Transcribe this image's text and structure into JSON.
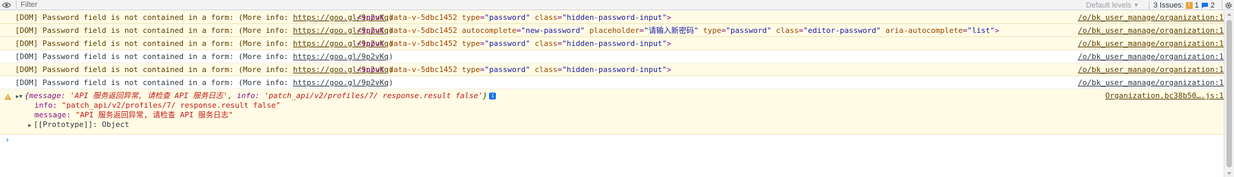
{
  "toolbar": {
    "filter_placeholder": "Filter",
    "levels_label": "Default levels",
    "issues_label": "3 Issues:",
    "warn_count": "1",
    "info_count": "2"
  },
  "log_rows": [
    {
      "type": "warn",
      "message_prefix": "[DOM] Password field is not contained in a form: (More info: ",
      "link": "https://goo.gl/9p2vKq",
      "message_suffix": ")",
      "element": {
        "open": "<input",
        "attrs": [
          {
            "name": "data-v-5dbc1452",
            "value": ""
          },
          {
            "name": "type",
            "value": "\"password\""
          },
          {
            "name": "class",
            "value": "\"hidden-password-input\""
          }
        ],
        "close": ">"
      },
      "source": "/o/bk_user_manage/organization:1"
    },
    {
      "type": "warn",
      "message_prefix": "[DOM] Password field is not contained in a form: (More info: ",
      "link": "https://goo.gl/9p2vKq",
      "message_suffix": ")",
      "element": {
        "open": "<input",
        "attrs": [
          {
            "name": "data-v-5dbc1452",
            "value": ""
          },
          {
            "name": "autocomplete",
            "value": "\"new-password\""
          },
          {
            "name": "placeholder",
            "value": "\"请输入新密码\""
          },
          {
            "name": "type",
            "value": "\"password\""
          },
          {
            "name": "class",
            "value": "\"editor-password\""
          },
          {
            "name": "aria-autocomplete",
            "value": "\"list\""
          }
        ],
        "close": ">"
      },
      "source": "/o/bk_user_manage/organization:1"
    },
    {
      "type": "warn",
      "message_prefix": "[DOM] Password field is not contained in a form: (More info: ",
      "link": "https://goo.gl/9p2vKq",
      "message_suffix": ")",
      "element": {
        "open": "<input",
        "attrs": [
          {
            "name": "data-v-5dbc1452",
            "value": ""
          },
          {
            "name": "type",
            "value": "\"password\""
          },
          {
            "name": "class",
            "value": "\"hidden-password-input\""
          }
        ],
        "close": ">"
      },
      "source": "/o/bk_user_manage/organization:1"
    },
    {
      "type": "info",
      "message_prefix": "[DOM] Password field is not contained in a form: (More info: ",
      "link": "https://goo.gl/9p2vKq",
      "message_suffix": ")",
      "element": null,
      "source": "/o/bk_user_manage/organization:1"
    },
    {
      "type": "warn",
      "message_prefix": "[DOM] Password field is not contained in a form: (More info: ",
      "link": "https://goo.gl/9p2vKq",
      "message_suffix": ")",
      "element": {
        "open": "<input",
        "attrs": [
          {
            "name": "data-v-5dbc1452",
            "value": ""
          },
          {
            "name": "type",
            "value": "\"password\""
          },
          {
            "name": "class",
            "value": "\"hidden-password-input\""
          }
        ],
        "close": ">"
      },
      "source": "/o/bk_user_manage/organization:1"
    },
    {
      "type": "info",
      "message_prefix": "[DOM] Password field is not contained in a form: (More info: ",
      "link": "https://goo.gl/9p2vKq",
      "message_suffix": ")",
      "element": null,
      "source": "/o/bk_user_manage/organization:1"
    }
  ],
  "object_warning": {
    "head_open": "{",
    "head_message_key": "message:",
    "head_message_val": "'API 服务返回异常, 请检查 API 服务日志'",
    "head_sep": ",",
    "head_info_key": "info:",
    "head_info_val": "'patch_api/v2/profiles/7/ response.result false'",
    "head_close": "}",
    "badge": "i",
    "info_key": "info:",
    "info_val": "\"patch_api/v2/profiles/7/ response.result false\"",
    "message_key": "message:",
    "message_val": "\"API 服务返回异常, 请检查 API 服务日志\"",
    "proto_label": "[[Prototype]]:",
    "proto_val": "Object",
    "source": "Organization.bc38b50….js:1"
  },
  "prompt_symbol": "›"
}
